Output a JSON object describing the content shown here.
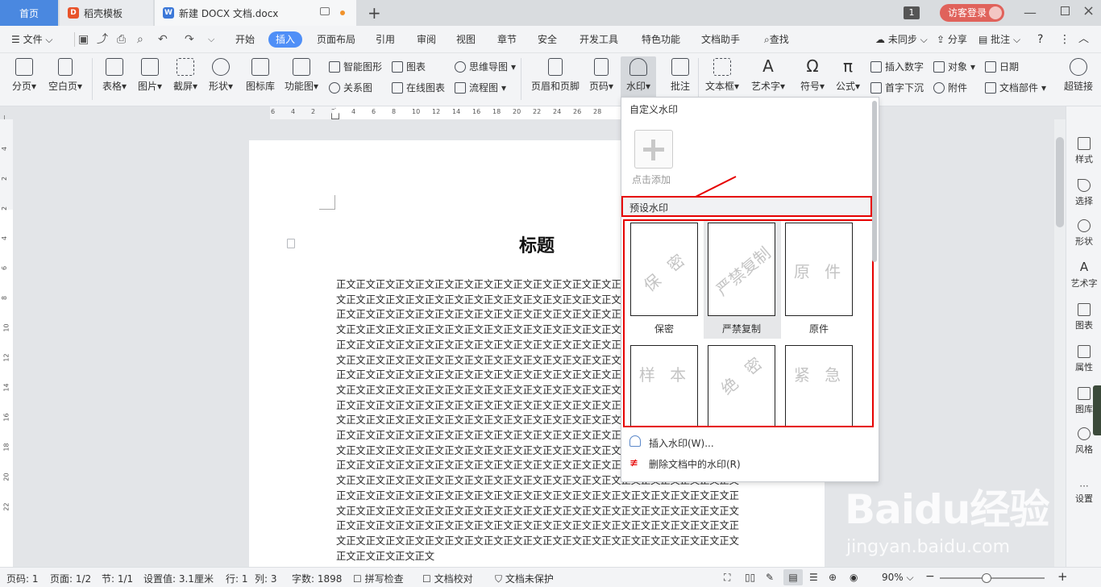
{
  "tabs": {
    "home": "首页",
    "template": "稻壳模板",
    "document": "新建 DOCX 文档.docx",
    "window_count": "1",
    "login": "访客登录"
  },
  "menubar": {
    "file": "文件",
    "items": [
      "开始",
      "插入",
      "页面布局",
      "引用",
      "审阅",
      "视图",
      "章节",
      "安全",
      "开发工具",
      "特色功能",
      "文档助手"
    ],
    "search": "查找",
    "sync": "未同步",
    "share": "分享",
    "comment": "批注",
    "help": "?"
  },
  "ribbon": {
    "page_break": "分页",
    "blank_page": "空白页",
    "table": "表格",
    "picture": "图片",
    "screenshot": "截屏",
    "shape": "形状",
    "icon_lib": "图标库",
    "func_chart": "功能图",
    "smart_shape": "智能图形",
    "relation": "关系图",
    "chart": "图表",
    "online_chart": "在线图表",
    "mind_map": "思维导图",
    "flowchart": "流程图",
    "header_footer": "页眉和页脚",
    "page_number": "页码",
    "watermark": "水印",
    "comment": "批注",
    "textbox": "文本框",
    "art_text": "艺术字",
    "symbol": "符号",
    "formula": "公式",
    "insert_number": "插入数字",
    "drop_cap": "首字下沉",
    "object": "对象",
    "attachment": "附件",
    "date": "日期",
    "doc_parts": "文档部件",
    "hyperlink": "超链接"
  },
  "ruler": {
    "h_ticks": [
      "6",
      "4",
      "2",
      "2",
      "4",
      "6",
      "8",
      "10",
      "12",
      "14",
      "16",
      "18",
      "20",
      "22",
      "24",
      "26",
      "28"
    ],
    "v_ticks": [
      "4",
      "2",
      "2",
      "4",
      "6",
      "8",
      "10",
      "12",
      "14",
      "16",
      "18",
      "20",
      "22"
    ]
  },
  "document": {
    "title": "标题",
    "body": "正文正文正文正文正文正文正文正文正文正文正文正文正文正文正文正文正文正文正文正文正文正文正文正文正文正文正文正文正文正文正文正文正文正文正文正文正文正文正文正文正文正文正文正文正文正文正文正文正文正文正文正文正文正文正文正文正文正文正文正文正文正文正文正文正文正文正文正文正文正文正文正文正文正文正文正文正文正文正文正文正文正文正文正文正文正文正文正文正文正文正文正文正文正文正文正文正文正文正文正文正文正文正文正文正文正文正文正文正文正文正文正文正文正文正文正文正文正文正文正文正文正文正文正文正文正文正文正文正文正文正文正文正文正文正文正文正文正文正文正文正文正文正文正文正文正文正文正文正文正文正文正文正文正文正文正文正文正文正文正文正文正文正文正文正文正文正文正文正文正文正文正文正文正文正文正文正文正文正文正文正文正文正文正文正文正文正文正文正文正文正文正文正文正文正文正文正文正文正文正文正文正文正文正文正文正文正文正文正文正文正文正文正文正文正文正文正文正文正文正文正文正文正文正文正文正文正文正文正文正文正文正文正文正文正文正文正文正文正文正文正文正文正文正文正文正文正文正文正文正文正文正文正文正文正文正文正文正文正文正文正文正文正文正文正文正文正文正文正文正文正文正文正文正文正文正文正文正文正文正文正文正文正文正文正文正文正文正文正文正文正文正文正文正文正文正文正文正文正文正文正文正文正文正文正文正文正文正文正文正文正文正文正文正文正文正文正文正文正文正文正文正文正文正文正文正文正文正文正文正文正文正文正文正文正文正文正文正文正文正文正文正文正文正文正文正文正文正文正文正文正文正文正文正文正文正文正文正文正文正文正文正文正文正文正文正文正文正文正文正文正文正文正文正文"
  },
  "watermark_menu": {
    "custom_header": "自定义水印",
    "add_label": "点击添加",
    "preset_header": "预设水印",
    "presets": [
      {
        "text": "保 密",
        "label": "保密"
      },
      {
        "text": "严禁复制",
        "label": "严禁复制"
      },
      {
        "text": "原 件",
        "label": "原件"
      },
      {
        "text": "样 本",
        "label": ""
      },
      {
        "text": "绝 密",
        "label": ""
      },
      {
        "text": "紧 急",
        "label": ""
      }
    ],
    "insert": "插入水印(W)...",
    "delete": "删除文档中的水印(R)"
  },
  "right_sidebar": [
    "样式",
    "选择",
    "形状",
    "艺术字",
    "图表",
    "属性",
    "图库",
    "风格",
    "设置"
  ],
  "statusbar": {
    "page": "页码: 1",
    "pages": "页面: 1/2",
    "section": "节: 1/1",
    "setting": "设置值: 3.1厘米",
    "row": "行: 1",
    "col": "列: 3",
    "words": "字数: 1898",
    "spell": "拼写检查",
    "proof": "文档校对",
    "protect": "文档未保护",
    "zoom": "90%"
  },
  "watermark_brand": {
    "logo": "Baidu经验",
    "url": "jingyan.baidu.com"
  },
  "colors": {
    "accent": "#4f8ff7",
    "highlight": "#e60000",
    "home_tab": "#4a88e0"
  }
}
